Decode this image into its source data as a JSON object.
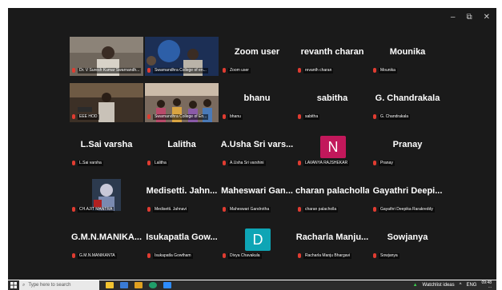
{
  "window_controls": {
    "minimize": "–",
    "restore": "⧉",
    "close": "✕"
  },
  "colors": {
    "active_speaker": "#2dbd4e",
    "muted_mic": "#e03c31",
    "avatar_n": "#c2185b",
    "avatar_d": "#0ea5b5"
  },
  "participants": [
    {
      "display": "",
      "label": "Dr. V Suresh Kumar Swarnandh..."
    },
    {
      "display": "",
      "label": "Swarnandhra College of en..."
    },
    {
      "display": "Zoom user",
      "label": "Zoom user"
    },
    {
      "display": "revanth charan",
      "label": "revanth charan"
    },
    {
      "display": "Mounika",
      "label": "Mounika"
    },
    {
      "display": "",
      "label": "EEE HOD"
    },
    {
      "display": "",
      "label": "Swarnandhra College of En..."
    },
    {
      "display": "bhanu",
      "label": "bhanu"
    },
    {
      "display": "sabitha",
      "label": "sabitha"
    },
    {
      "display": "G. Chandrakala",
      "label": "G. Chandrakala"
    },
    {
      "display": "L.Sai varsha",
      "label": "L.Sai varsha"
    },
    {
      "display": "Lalitha",
      "label": "Lalitha"
    },
    {
      "display": "A.Usha Sri vars...",
      "label": "A.Usha Sri varshini"
    },
    {
      "display": "",
      "avatar": "N",
      "label": "LAVANYA RAJSHEKAR"
    },
    {
      "display": "Pranay",
      "label": "Pranay"
    },
    {
      "display": "",
      "label": "CH.AJIT MANTRA"
    },
    {
      "display": "Medisetti. Jahn...",
      "label": "Medisetti. Jahnavi"
    },
    {
      "display": "Maheswari Gan...",
      "label": "Maheswari Gandrotha"
    },
    {
      "display": "charan palacholla",
      "label": "charan palacholla"
    },
    {
      "display": "Gayathri Deepi...",
      "label": "Gayathri Deepika Rarakreddy"
    },
    {
      "display": "G.M.N.MANIKA...",
      "label": "G.M.N.MANIKANTA"
    },
    {
      "display": "Isukapatla Gow...",
      "label": "Isukapatla Gowtham"
    },
    {
      "display": "",
      "avatar": "D",
      "label": "Divya Chavakula"
    },
    {
      "display": "Racharla Manju...",
      "label": "Racharla Manju Bhargavi"
    },
    {
      "display": "Sowjanya",
      "label": "Sowjanya"
    }
  ],
  "taskbar": {
    "search_placeholder": "Type here to search",
    "watchlist": "Watchlist ideas",
    "lang": "ENG",
    "time": "09:48",
    "date": "..."
  }
}
